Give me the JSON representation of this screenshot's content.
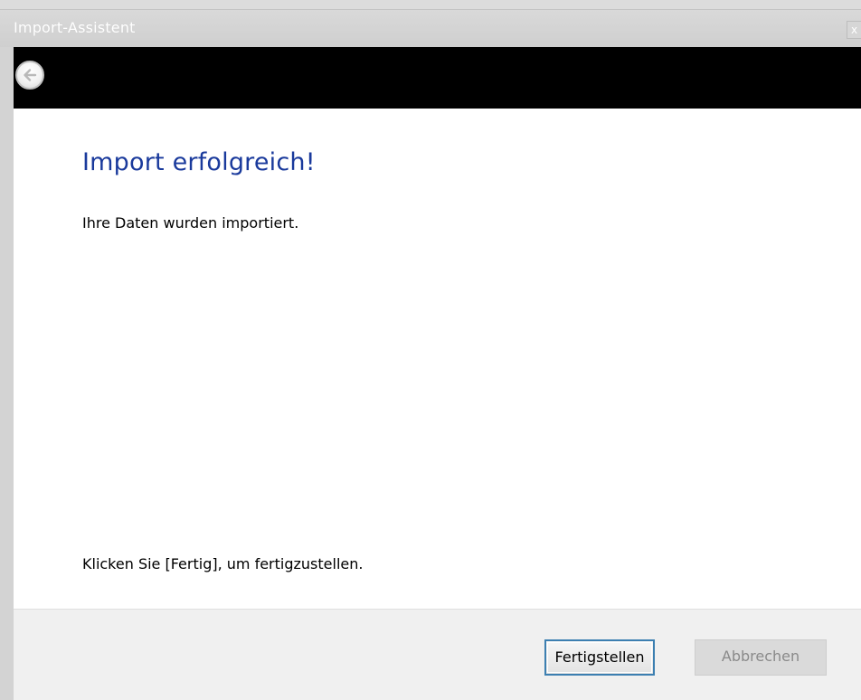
{
  "window": {
    "title": "Import-Assistent",
    "close_glyph": "x"
  },
  "nav": {
    "back_icon": "back-arrow-icon"
  },
  "content": {
    "heading": "Import erfolgreich!",
    "message": "Ihre Daten wurden importiert.",
    "hint": "Klicken Sie [Fertig], um fertigzustellen."
  },
  "footer": {
    "finish_label": "Fertigstellen",
    "cancel_label": "Abbrechen"
  },
  "colors": {
    "heading": "#1a3a9c",
    "nav_band": "#000000",
    "focus_border": "#3c7fb1"
  }
}
